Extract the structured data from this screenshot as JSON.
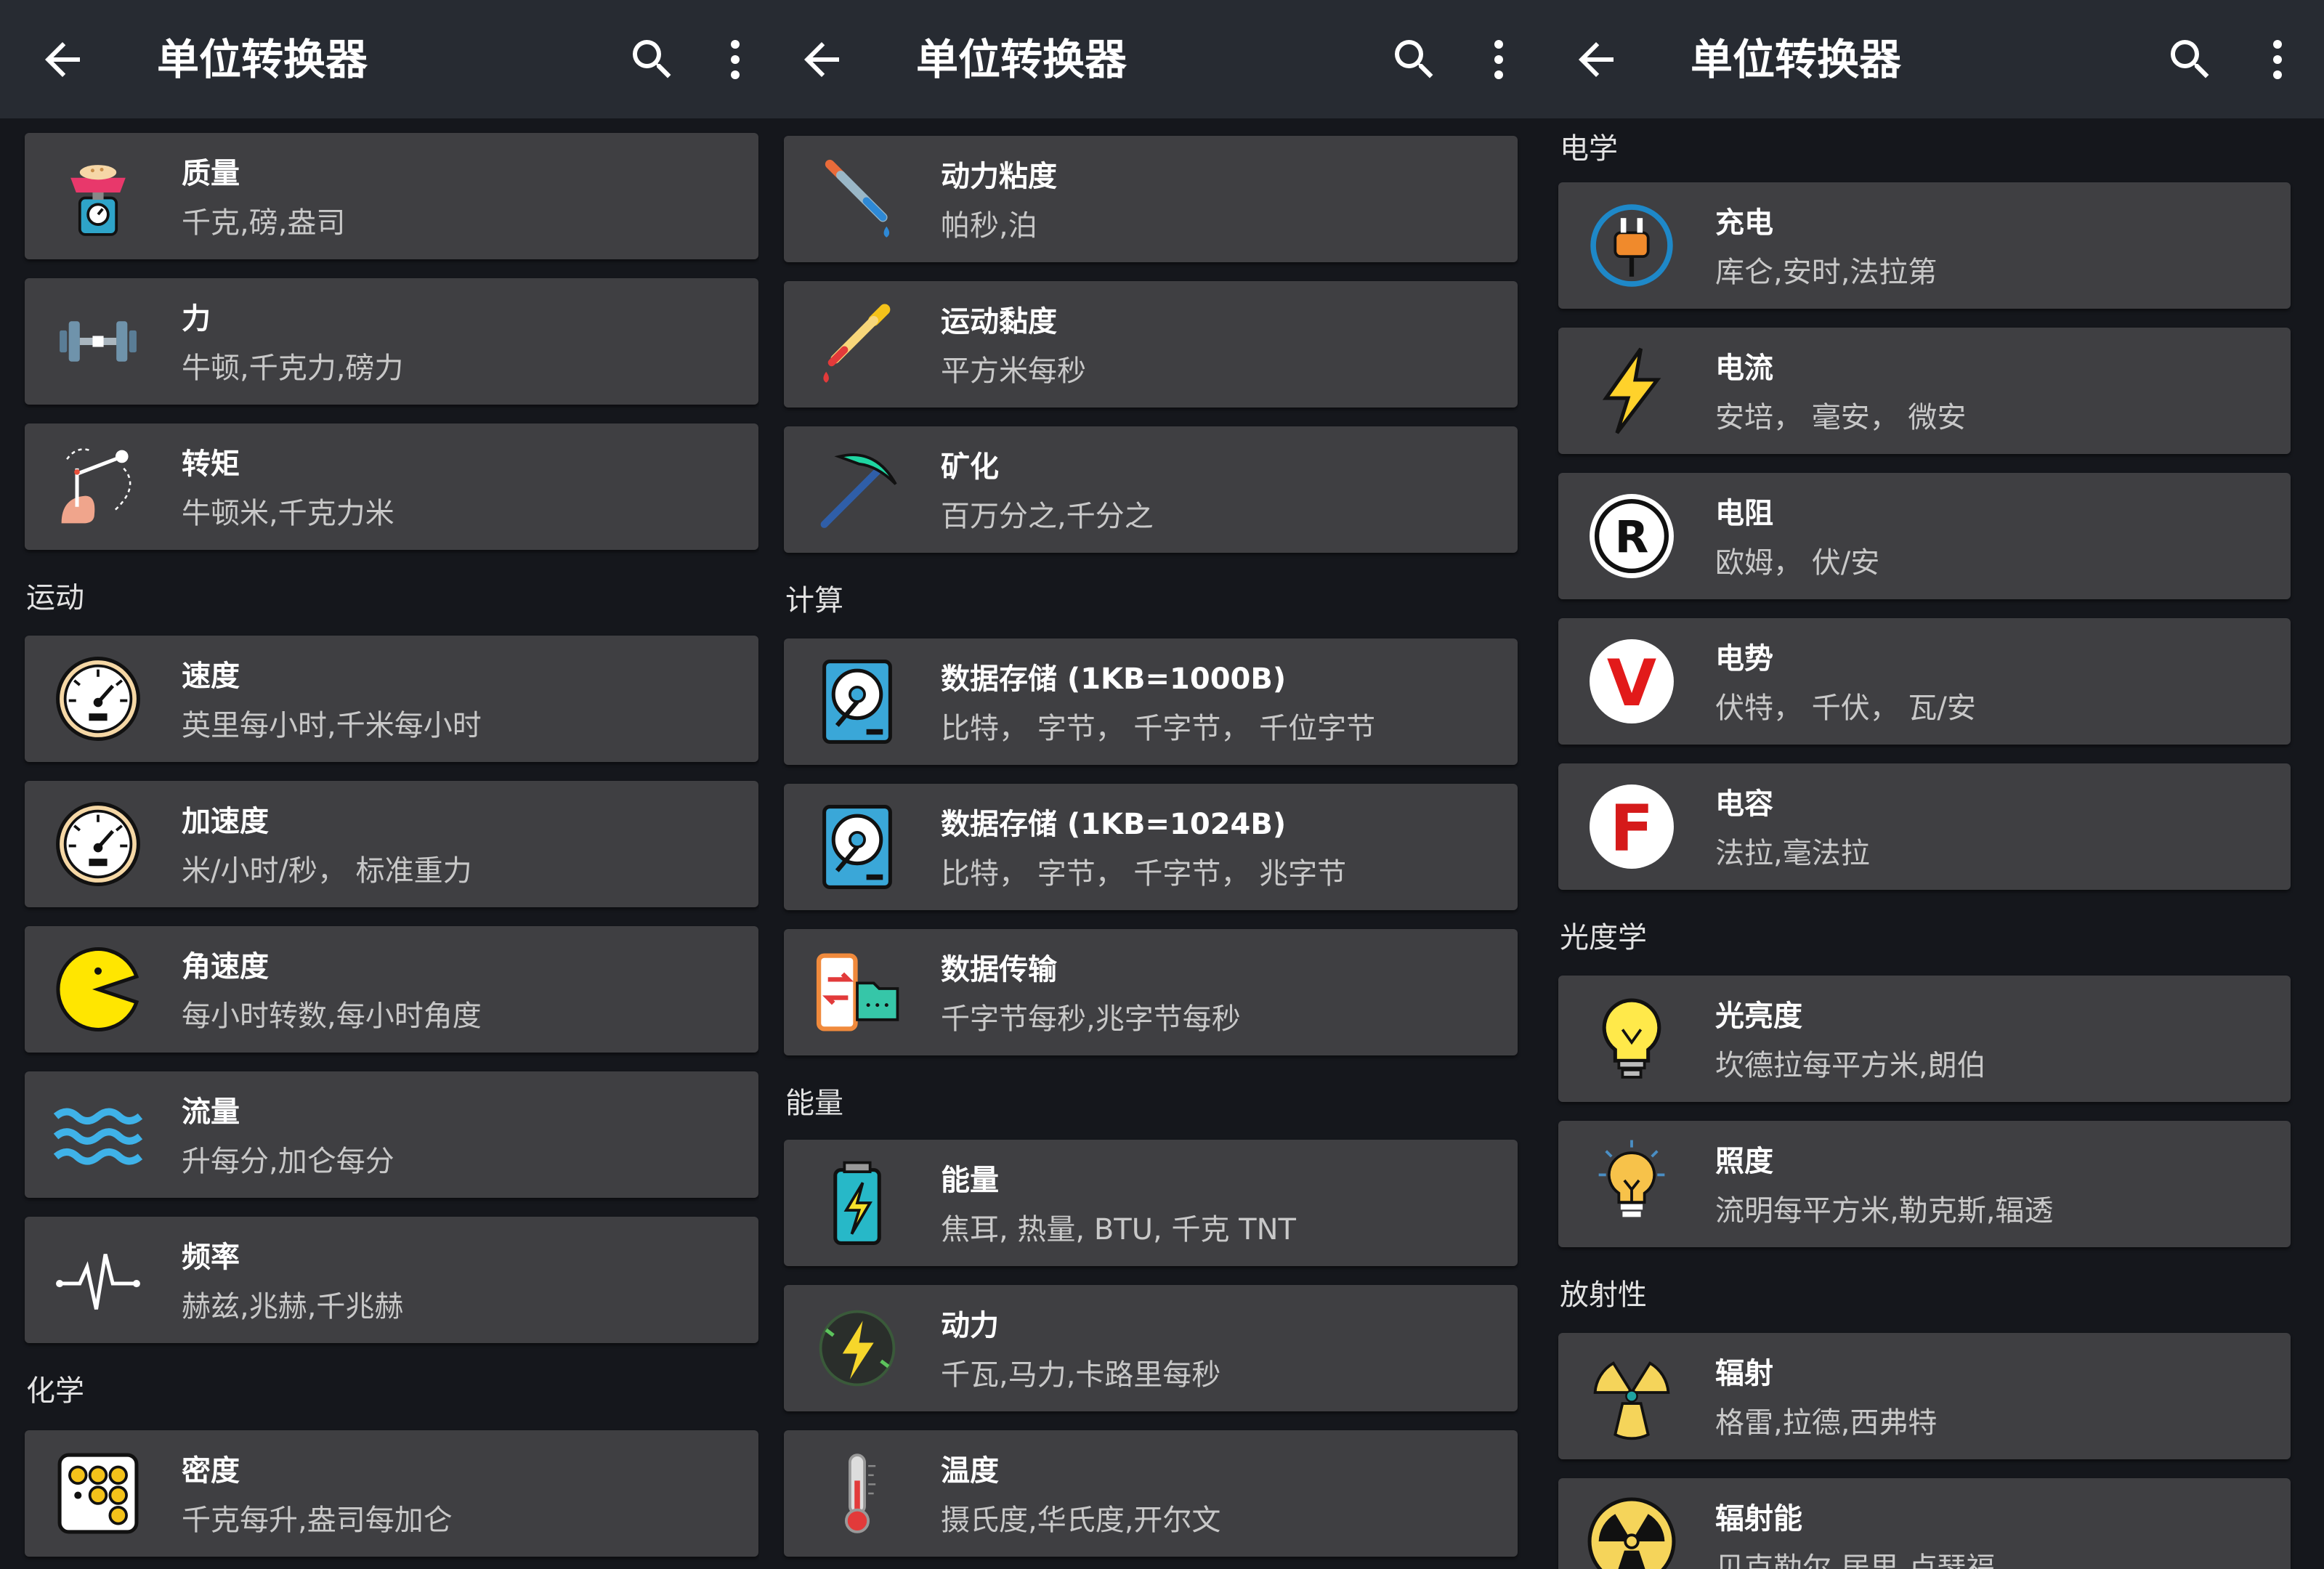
{
  "app": {
    "title": "单位转换器"
  },
  "screens": [
    {
      "items": [
        {
          "kind": "card",
          "name": "质量",
          "units": "千克,磅,盎司",
          "icon": "scale-icon"
        },
        {
          "kind": "card",
          "name": "力",
          "units": "牛顿,千克力,磅力",
          "icon": "dumbbell-icon"
        },
        {
          "kind": "card",
          "name": "转矩",
          "units": "牛顿米,千克力米",
          "icon": "torque-icon"
        },
        {
          "kind": "header",
          "label": "运动"
        },
        {
          "kind": "card",
          "name": "速度",
          "units": "英里每小时,千米每小时",
          "icon": "speedometer-icon"
        },
        {
          "kind": "card",
          "name": "加速度",
          "units": "米/小时/秒， 标准重力",
          "icon": "speedometer-icon"
        },
        {
          "kind": "card",
          "name": "角速度",
          "units": "每小时转数,每小时角度",
          "icon": "pie-angle-icon"
        },
        {
          "kind": "card",
          "name": "流量",
          "units": "升每分,加仑每分",
          "icon": "waves-icon"
        },
        {
          "kind": "card",
          "name": "频率",
          "units": "赫兹,兆赫,千兆赫",
          "icon": "pulse-icon"
        },
        {
          "kind": "header",
          "label": "化学"
        },
        {
          "kind": "card",
          "name": "密度",
          "units": "千克每升,盎司每加仑",
          "icon": "dots-grid-icon"
        }
      ]
    },
    {
      "items": [
        {
          "kind": "card",
          "name": "动力粘度",
          "units": "帕秒,泊",
          "icon": "dropper-blue-icon"
        },
        {
          "kind": "card",
          "name": "运动黏度",
          "units": "平方米每秒",
          "icon": "dropper-red-icon"
        },
        {
          "kind": "card",
          "name": "矿化",
          "units": "百万分之,千分之",
          "icon": "pickaxe-icon"
        },
        {
          "kind": "header",
          "label": "计算"
        },
        {
          "kind": "card",
          "name": "数据存储 (1KB=1000B)",
          "units": "比特， 字节， 千字节， 千位字节",
          "icon": "hard-disk-icon"
        },
        {
          "kind": "card",
          "name": "数据存储 (1KB=1024B)",
          "units": "比特， 字节， 千字节， 兆字节",
          "icon": "hard-disk-icon"
        },
        {
          "kind": "card",
          "name": "数据传输",
          "units": "千字节每秒,兆字节每秒",
          "icon": "data-transfer-icon"
        },
        {
          "kind": "header",
          "label": "能量"
        },
        {
          "kind": "card",
          "name": "能量",
          "units": "焦耳, 热量, BTU, 千克 TNT",
          "icon": "battery-bolt-icon"
        },
        {
          "kind": "card",
          "name": "动力",
          "units": "千瓦,马力,卡路里每秒",
          "icon": "power-bolt-icon"
        },
        {
          "kind": "card",
          "name": "温度",
          "units": "摄氏度,华氏度,开尔文",
          "icon": "thermometer-icon"
        }
      ]
    },
    {
      "items": [
        {
          "kind": "header",
          "label": "电学"
        },
        {
          "kind": "card",
          "name": "充电",
          "units": "库仑,安时,法拉第",
          "icon": "plug-icon"
        },
        {
          "kind": "card",
          "name": "电流",
          "units": "安培， 毫安， 微安",
          "icon": "lightning-icon"
        },
        {
          "kind": "card",
          "name": "电阻",
          "units": "欧姆， 伏/安",
          "icon": "r-badge-icon"
        },
        {
          "kind": "card",
          "name": "电势",
          "units": "伏特， 千伏， 瓦/安",
          "icon": "v-badge-icon"
        },
        {
          "kind": "card",
          "name": "电容",
          "units": "法拉,毫法拉",
          "icon": "f-badge-icon"
        },
        {
          "kind": "header",
          "label": "光度学"
        },
        {
          "kind": "card",
          "name": "光亮度",
          "units": "坎德拉每平方米,朗伯",
          "icon": "light-bulb-icon"
        },
        {
          "kind": "card",
          "name": "照度",
          "units": "流明每平方米,勒克斯,辐透",
          "icon": "bulb-rays-icon"
        },
        {
          "kind": "header",
          "label": "放射性"
        },
        {
          "kind": "card",
          "name": "辐射",
          "units": "格雷,拉德,西弗特",
          "icon": "radiation-icon"
        },
        {
          "kind": "card",
          "name": "辐射能",
          "units": "贝克勒尔,居里,卢瑟福",
          "icon": "radiation-circle-icon"
        }
      ]
    }
  ]
}
